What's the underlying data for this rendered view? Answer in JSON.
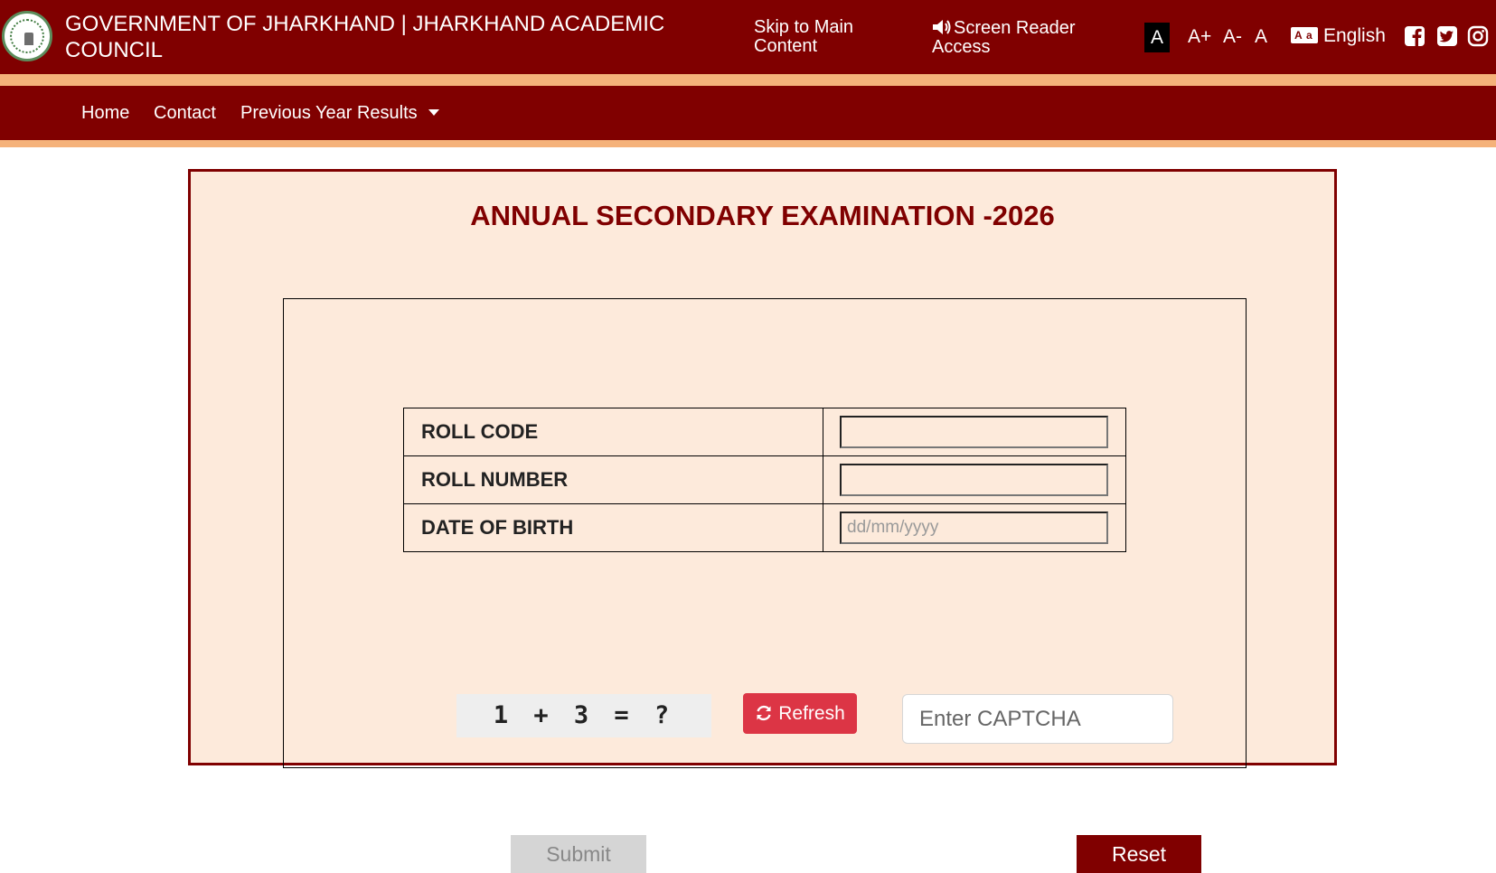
{
  "header": {
    "title": "GOVERNMENT OF JHARKHAND | JHARKHAND ACADEMIC COUNCIL",
    "skip_link": "Skip to Main Content",
    "screen_reader": "Screen Reader Access",
    "font_sizes": {
      "normal_active": "A",
      "increase": "A+",
      "decrease": "A-",
      "reset": "A"
    },
    "language": "English",
    "language_icon_text": [
      "A",
      "a"
    ]
  },
  "nav": {
    "items": [
      "Home",
      "Contact",
      "Previous Year Results"
    ]
  },
  "main": {
    "title": "ANNUAL SECONDARY EXAMINATION -2026",
    "form": {
      "rows": [
        {
          "label": "ROLL CODE",
          "value": "",
          "placeholder": ""
        },
        {
          "label": "ROLL NUMBER",
          "value": "",
          "placeholder": ""
        },
        {
          "label": "DATE OF BIRTH",
          "value": "",
          "placeholder": "dd/mm/yyyy"
        }
      ]
    },
    "captcha": {
      "question": "1 + 3 = ?",
      "refresh_label": "Refresh",
      "input_placeholder": "Enter CAPTCHA"
    },
    "submit_label": "Submit",
    "reset_label": "Reset"
  },
  "colors": {
    "primary": "#800000",
    "accent_band": "#f5b27a",
    "panel_bg": "#fdeadb",
    "refresh": "#dc3545"
  },
  "icons": [
    "emblem-logo",
    "speaker-icon",
    "language-icon",
    "facebook-icon",
    "twitter-icon",
    "instagram-icon",
    "caret-down-icon",
    "refresh-icon"
  ]
}
